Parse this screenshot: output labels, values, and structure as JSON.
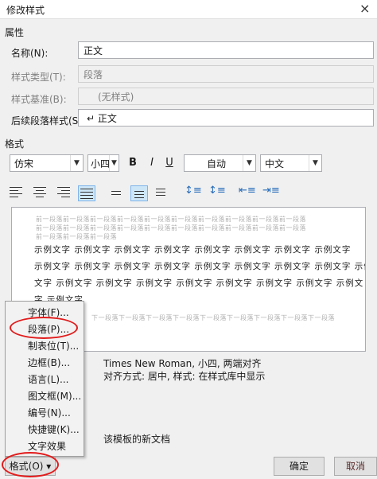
{
  "window": {
    "title": "修改样式",
    "close_glyph": "×"
  },
  "properties": {
    "section_label": "属性",
    "name_label": "名称(N):",
    "name_value": "正文",
    "style_type_label": "样式类型(T):",
    "style_type_value": "段落",
    "style_based_label": "样式基准(B):",
    "style_based_value": "(无样式)",
    "next_style_label": "后续段落样式(S):",
    "next_style_value": "↵ 正文"
  },
  "format": {
    "section_label": "格式",
    "font": "仿宋",
    "size": "小四",
    "bold": "B",
    "italic": "I",
    "underline": "U",
    "color": "自动",
    "lang": "中文"
  },
  "preview": {
    "prev_para_lines": [
      "前一段落前一段落前一段落前一段落前一段落前一段落前一段落前一段落前一段落前一段落",
      "前一段落前一段落前一段落前一段落前一段落前一段落前一段落前一段落前一段落前一段落",
      "前一段落前一段落前一段落"
    ],
    "sample_lines": [
      "示例文字 示例文字 示例文字 示例文字 示例文字 示例文字 示例文字 示例文字",
      "示例文字 示例文字 示例文字 示例文字 示例文字 示例文字 示例文字 示例文字 示例",
      "文字 示例文字 示例文字 示例文字 示例文字 示例文字 示例文字 示例文字 示例文",
      "字 示例文字"
    ],
    "next_para_line": "下一段落下一段落下一段落下一段落下一段落下一段落下一段落下一段落下一段落"
  },
  "description": {
    "line1": "Times New Roman, 小四, 两端对齐",
    "line2": "对齐方式: 居中, 样式: 在样式库中显示"
  },
  "template_option": "该模板的新文档",
  "menu": {
    "items": [
      "字体(F)...",
      "段落(P)...",
      "制表位(T)...",
      "边框(B)...",
      "语言(L)...",
      "图文框(M)...",
      "编号(N)...",
      "快捷键(K)...",
      "文字效果(E)..."
    ]
  },
  "buttons": {
    "format": "格式(O) ▾",
    "ok": "确定",
    "cancel": "取消"
  },
  "colors": {
    "highlight": "#e21b1b",
    "active_button": "#cde6f7"
  }
}
